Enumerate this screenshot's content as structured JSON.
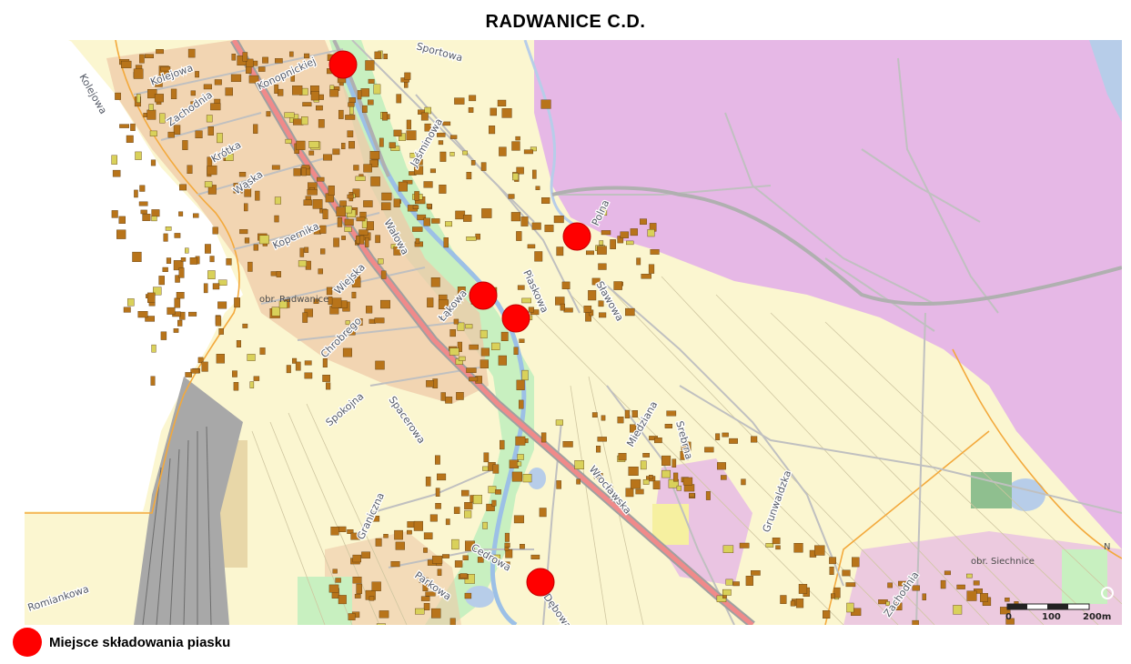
{
  "title": "RADWANICE C.D.",
  "legend": {
    "label": "Miejsce składowania piasku",
    "color": "#ff0000"
  },
  "colors": {
    "residential": "#fbf6d0",
    "built_up": "#efc9a8",
    "forest_zone": "#e6b8e6",
    "greenery": "#c8f0c0",
    "water": "#b7cde9",
    "railway": "#9a9a9a",
    "main_road": "#f08a8a",
    "district_boundary": "#f3a93c",
    "building": "#b8741a"
  },
  "streets": [
    "Kolejowa",
    "Kolejowa",
    "Zachodnia",
    "Krótka",
    "Wąska",
    "Kopernika",
    "Konopnickiej",
    "Sportowa",
    "Jaśminowa",
    "Wałowa",
    "Łąkowa",
    "Polna",
    "Sławowa",
    "Piaskowa",
    "Wiejska",
    "Spokojna",
    "Spacerowa",
    "Miedziana",
    "Srebrna",
    "Wrocławska",
    "Graniczna",
    "Cedrowa",
    "Parkowa",
    "Dębowa",
    "Chrobrego",
    "Grunwaldzka",
    "Romiankowa",
    "Zachodnia"
  ],
  "area_labels": [
    "obr. Radwanice",
    "obr. Siechnice"
  ],
  "markers": [
    {
      "name": "marker-1"
    },
    {
      "name": "marker-2"
    },
    {
      "name": "marker-3"
    },
    {
      "name": "marker-4"
    },
    {
      "name": "marker-5"
    }
  ],
  "scale": {
    "labels": [
      "0",
      "100",
      "200m"
    ]
  },
  "compass_label": "N"
}
